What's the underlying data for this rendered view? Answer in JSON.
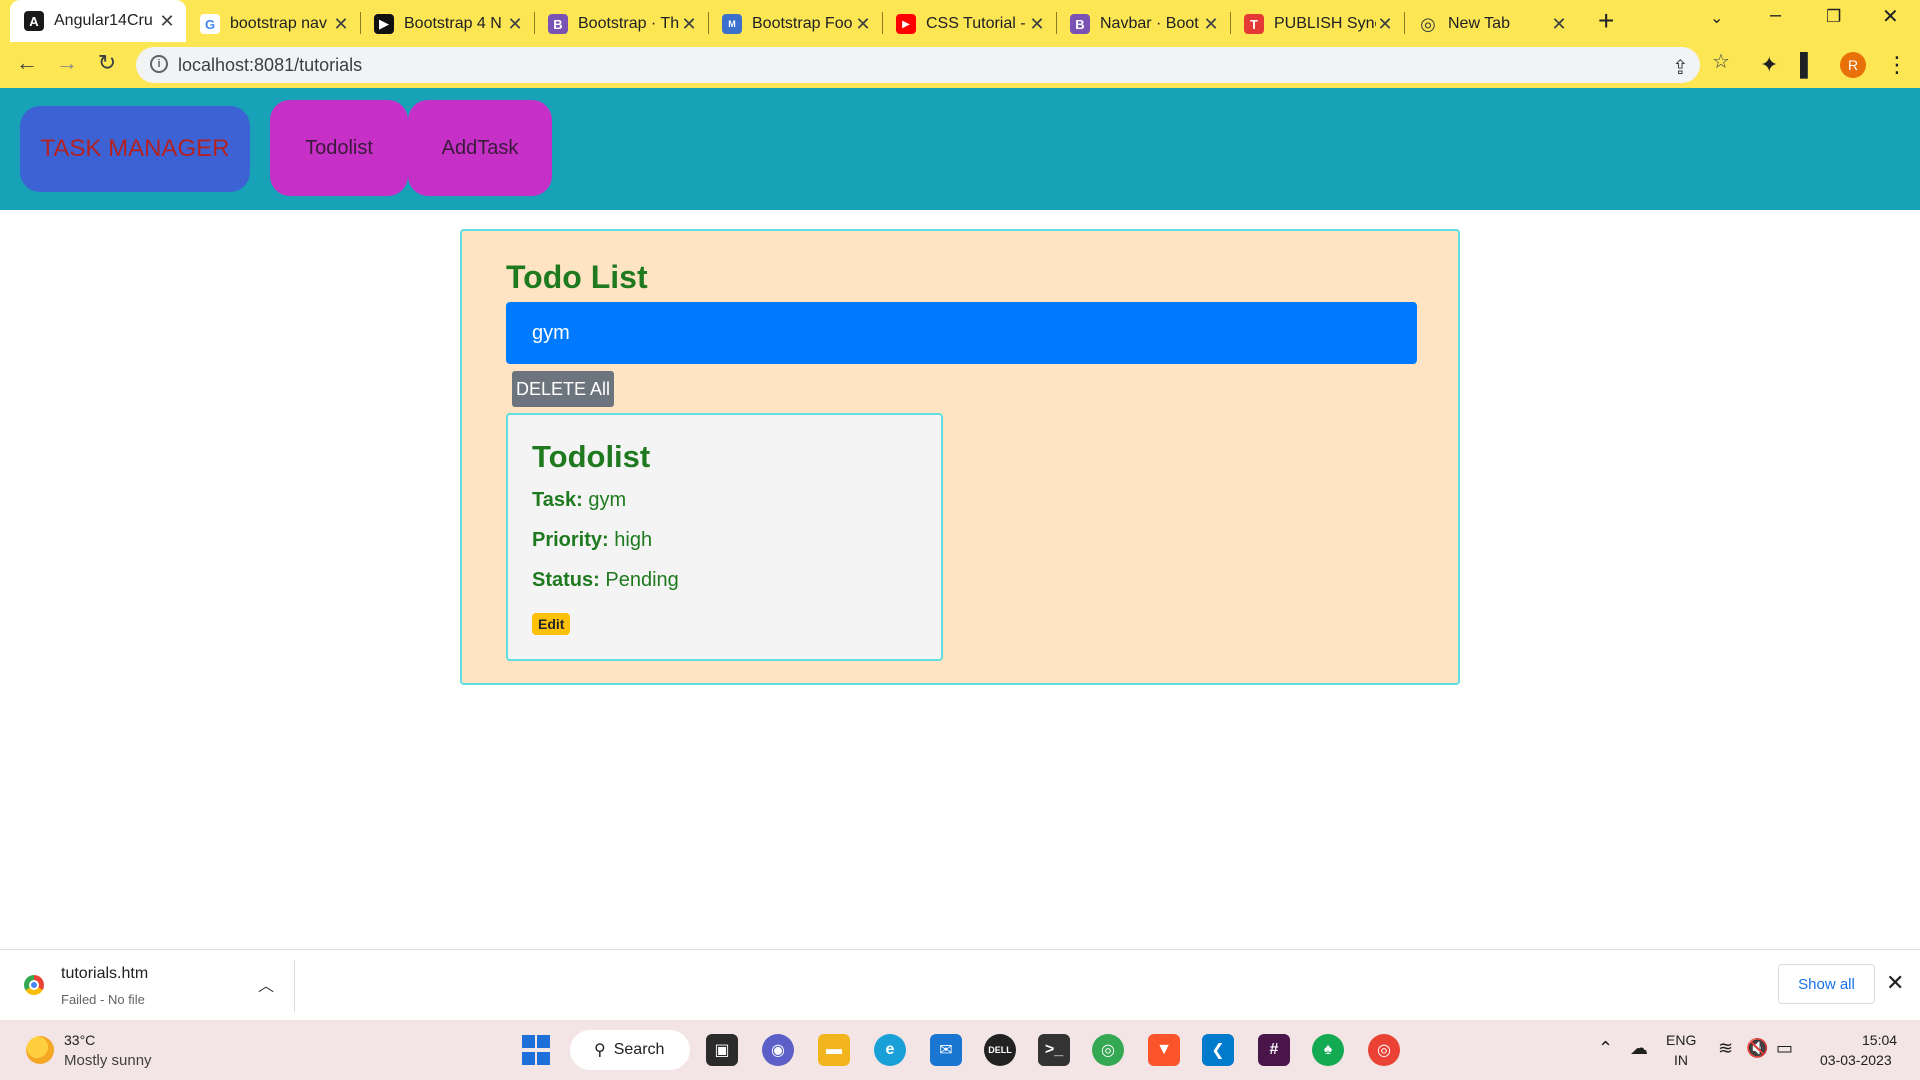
{
  "browser": {
    "tabs": [
      {
        "title": "Angular14Cru",
        "icon": "angular-icon",
        "color": "#c3002f",
        "glyph": "A",
        "active": true
      },
      {
        "title": "bootstrap nav",
        "icon": "google-icon",
        "color": "#4285f4",
        "glyph": "G",
        "active": false
      },
      {
        "title": "Bootstrap 4 N",
        "icon": "video-icon",
        "color": "#111111",
        "glyph": "▶",
        "active": false
      },
      {
        "title": "Bootstrap · Th",
        "icon": "bootstrap-icon",
        "color": "#7952b3",
        "glyph": "B",
        "active": false
      },
      {
        "title": "Bootstrap Foo",
        "icon": "mdb-icon",
        "color": "#3b71ca",
        "glyph": "M",
        "active": false
      },
      {
        "title": "CSS Tutorial -",
        "icon": "youtube-icon",
        "color": "#ff0000",
        "glyph": "▶",
        "active": false
      },
      {
        "title": "Navbar · Boot",
        "icon": "bootstrap-icon",
        "color": "#7952b3",
        "glyph": "B",
        "active": false
      },
      {
        "title": "PUBLISH Sync",
        "icon": "publish-icon",
        "color": "#e53935",
        "glyph": "T",
        "active": false
      },
      {
        "title": "New Tab",
        "icon": "chrome-icon",
        "color": "#5f6368",
        "glyph": "◎",
        "active": false
      }
    ],
    "url": "localhost:8081/tutorials",
    "profile_initial": "R"
  },
  "navbar": {
    "brand": "TASK MANAGER",
    "links": [
      "Todolist",
      "AddTask"
    ]
  },
  "todo": {
    "title": "Todo List",
    "items": [
      "gym"
    ],
    "delete_all_label": "DELETE All",
    "card": {
      "title": "Todolist",
      "task_label": "Task:",
      "task_value": "gym",
      "priority_label": "Priority:",
      "priority_value": "high",
      "status_label": "Status:",
      "status_value": "Pending",
      "edit_label": "Edit"
    }
  },
  "downloads": {
    "file_name": "tutorials.htm",
    "status": "Failed - No file",
    "show_all_label": "Show all"
  },
  "taskbar": {
    "temperature": "33°C",
    "weather": "Mostly sunny",
    "search_label": "Search",
    "language": "ENG",
    "region": "IN",
    "time": "15:04",
    "date": "03-03-2023",
    "apps": [
      "task-view-icon",
      "teams-chat-icon",
      "file-explorer-icon",
      "edge-icon",
      "mail-icon",
      "dell-icon",
      "terminal-icon",
      "chrome-icon",
      "brave-icon",
      "vscode-icon",
      "slack-icon",
      "mongodb-icon",
      "chrome-profile-icon"
    ]
  },
  "colors": {
    "chrome_accent": "#fce654",
    "navbar_bg": "#17a2b8",
    "brand_bg": "#3d62d4",
    "nav_link_bg": "#c630c6",
    "panel_bg": "#ffe4c4",
    "list_item_bg": "#007bff",
    "text_green": "#1f7a1f",
    "edit_badge": "#ffc107"
  }
}
